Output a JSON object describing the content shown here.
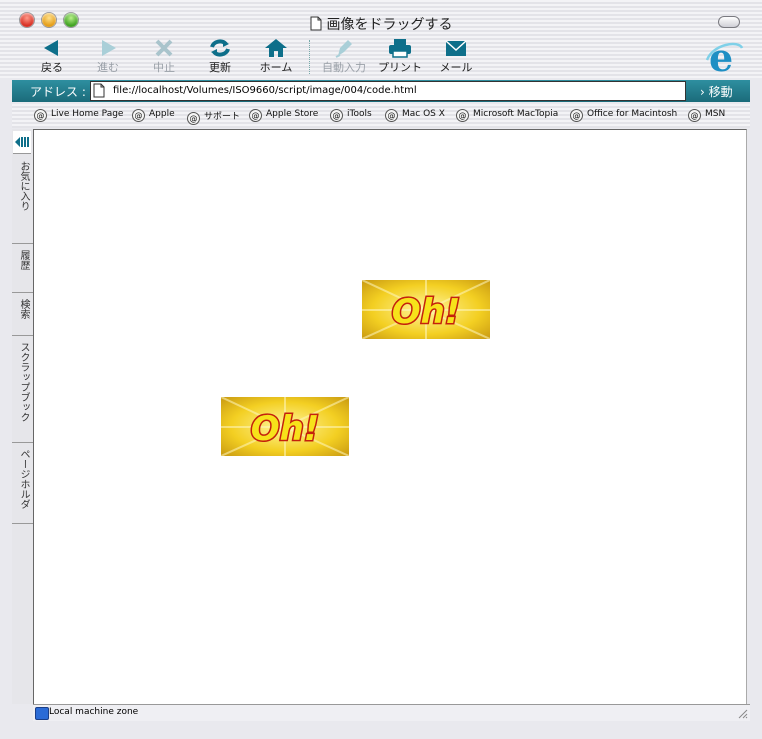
{
  "window": {
    "title": "画像をドラッグする"
  },
  "toolbar": {
    "buttons": [
      {
        "label": "戻る",
        "icon": "back-arrow-icon",
        "enabled": true
      },
      {
        "label": "進む",
        "icon": "forward-arrow-icon",
        "enabled": false
      },
      {
        "label": "中止",
        "icon": "stop-x-icon",
        "enabled": false
      },
      {
        "label": "更新",
        "icon": "refresh-icon",
        "enabled": true
      },
      {
        "label": "ホーム",
        "icon": "home-icon",
        "enabled": true
      },
      {
        "label": "自動入力",
        "icon": "autofill-icon",
        "enabled": false
      },
      {
        "label": "プリント",
        "icon": "print-icon",
        "enabled": true
      },
      {
        "label": "メール",
        "icon": "mail-icon",
        "enabled": true
      }
    ]
  },
  "address": {
    "label": "アドレス :",
    "url": "file://localhost/Volumes/ISO9660/script/image/004/code.html",
    "go_label": "移動"
  },
  "favorites": [
    "Live Home Page",
    "Apple",
    "サポート",
    "Apple Store",
    "iTools",
    "Mac OS X",
    "Microsoft MacTopia",
    "Office for Macintosh",
    "MSN"
  ],
  "sidebar": {
    "tabs": [
      "お気に入り",
      "履歴",
      "検索",
      "スクラップブック",
      "ページホルダ"
    ]
  },
  "content": {
    "images": [
      {
        "text": "Oh!"
      },
      {
        "text": "Oh!"
      }
    ]
  },
  "status": {
    "text": "Local machine zone"
  },
  "colors": {
    "accent": "#1b6b7a",
    "toolbar_icon": "#0e6f8a",
    "oh_text": "#d42a10",
    "oh_bg": "#f5cf1c"
  }
}
